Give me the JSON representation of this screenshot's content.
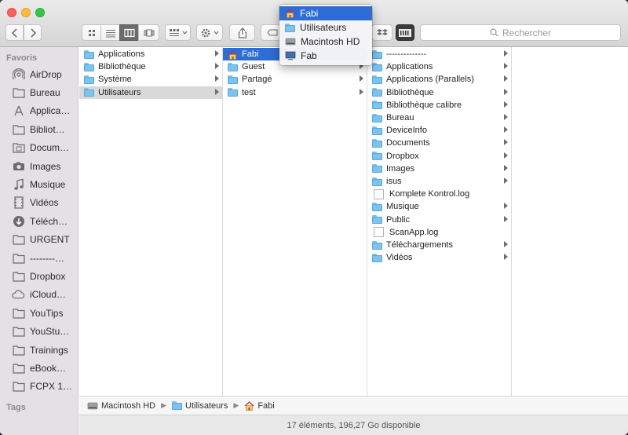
{
  "toolbar": {
    "search_placeholder": "Rechercher",
    "view_buttons": [
      "icon-view",
      "list-view",
      "column-view",
      "cover-flow-view"
    ],
    "active_view": "column-view"
  },
  "popup_menu": {
    "items": [
      {
        "label": "Fabi",
        "icon": "home-icon",
        "highlighted": true
      },
      {
        "label": "Utilisateurs",
        "icon": "folder-icon",
        "highlighted": false
      },
      {
        "label": "Macintosh HD",
        "icon": "hard-drive-icon",
        "highlighted": false
      },
      {
        "label": "Fab",
        "icon": "computer-icon",
        "highlighted": false
      }
    ]
  },
  "sidebar": {
    "favorites_header": "Favoris",
    "tags_header": "Tags",
    "items": [
      {
        "label": "AirDrop",
        "icon": "airdrop-icon"
      },
      {
        "label": "Bureau",
        "icon": "folder-icon"
      },
      {
        "label": "Applica…",
        "icon": "applications-icon"
      },
      {
        "label": "Bibliot…",
        "icon": "folder-icon"
      },
      {
        "label": "Docum…",
        "icon": "documents-icon"
      },
      {
        "label": "Images",
        "icon": "camera-icon"
      },
      {
        "label": "Musique",
        "icon": "music-note-icon"
      },
      {
        "label": "Vidéos",
        "icon": "film-icon"
      },
      {
        "label": "Téléch…",
        "icon": "download-icon"
      },
      {
        "label": "URGENT",
        "icon": "folder-icon"
      },
      {
        "label": "--------…",
        "icon": "folder-icon"
      },
      {
        "label": "Dropbox",
        "icon": "folder-icon"
      },
      {
        "label": "iCloud…",
        "icon": "cloud-icon"
      },
      {
        "label": "YouTips",
        "icon": "folder-icon"
      },
      {
        "label": "YouStu…",
        "icon": "folder-icon"
      },
      {
        "label": "Trainings",
        "icon": "folder-icon"
      },
      {
        "label": "eBook…",
        "icon": "folder-icon"
      },
      {
        "label": "FCPX 1…",
        "icon": "folder-icon"
      }
    ]
  },
  "columns": [
    {
      "items": [
        {
          "label": "Applications",
          "type": "folder",
          "arrow": true,
          "selected": ""
        },
        {
          "label": "Bibliothèque",
          "type": "folder",
          "arrow": true,
          "selected": ""
        },
        {
          "label": "Système",
          "type": "folder",
          "arrow": true,
          "selected": ""
        },
        {
          "label": "Utilisateurs",
          "type": "folder",
          "arrow": true,
          "selected": "inactive"
        }
      ]
    },
    {
      "items": [
        {
          "label": "Fabi",
          "type": "home",
          "arrow": true,
          "selected": "active"
        },
        {
          "label": "Guest",
          "type": "folder",
          "arrow": true,
          "selected": ""
        },
        {
          "label": "Partagé",
          "type": "folder",
          "arrow": true,
          "selected": ""
        },
        {
          "label": "test",
          "type": "folder",
          "arrow": true,
          "selected": ""
        }
      ]
    },
    {
      "items": [
        {
          "label": "--------------",
          "type": "folder",
          "arrow": true,
          "selected": ""
        },
        {
          "label": "Applications",
          "type": "folder",
          "arrow": true,
          "selected": ""
        },
        {
          "label": "Applications (Parallels)",
          "type": "folder",
          "arrow": true,
          "selected": ""
        },
        {
          "label": "Bibliothèque",
          "type": "folder",
          "arrow": true,
          "selected": ""
        },
        {
          "label": "Bibliothèque calibre",
          "type": "folder",
          "arrow": true,
          "selected": ""
        },
        {
          "label": "Bureau",
          "type": "folder",
          "arrow": true,
          "selected": ""
        },
        {
          "label": "DeviceInfo",
          "type": "folder",
          "arrow": true,
          "selected": ""
        },
        {
          "label": "Documents",
          "type": "folder",
          "arrow": true,
          "selected": ""
        },
        {
          "label": "Dropbox",
          "type": "folder",
          "arrow": true,
          "selected": ""
        },
        {
          "label": "Images",
          "type": "folder",
          "arrow": true,
          "selected": ""
        },
        {
          "label": "isus",
          "type": "folder",
          "arrow": true,
          "selected": ""
        },
        {
          "label": "Komplete Kontrol.log",
          "type": "document",
          "arrow": false,
          "selected": ""
        },
        {
          "label": "Musique",
          "type": "folder",
          "arrow": true,
          "selected": ""
        },
        {
          "label": "Public",
          "type": "folder",
          "arrow": true,
          "selected": ""
        },
        {
          "label": "ScanApp.log",
          "type": "document",
          "arrow": false,
          "selected": ""
        },
        {
          "label": "Téléchargements",
          "type": "folder",
          "arrow": true,
          "selected": ""
        },
        {
          "label": "Vidéos",
          "type": "folder",
          "arrow": true,
          "selected": ""
        }
      ]
    }
  ],
  "pathbar": {
    "items": [
      {
        "label": "Macintosh HD",
        "icon": "hard-drive-icon"
      },
      {
        "label": "Utilisateurs",
        "icon": "folder-icon"
      },
      {
        "label": "Fabi",
        "icon": "home-icon"
      }
    ]
  },
  "status": {
    "text": "17 éléments, 196,27 Go disponible"
  },
  "colors": {
    "selection": "#2e6cd6",
    "folder": "#7ec3ee",
    "sidebar_bg": "#e3e1e3"
  }
}
